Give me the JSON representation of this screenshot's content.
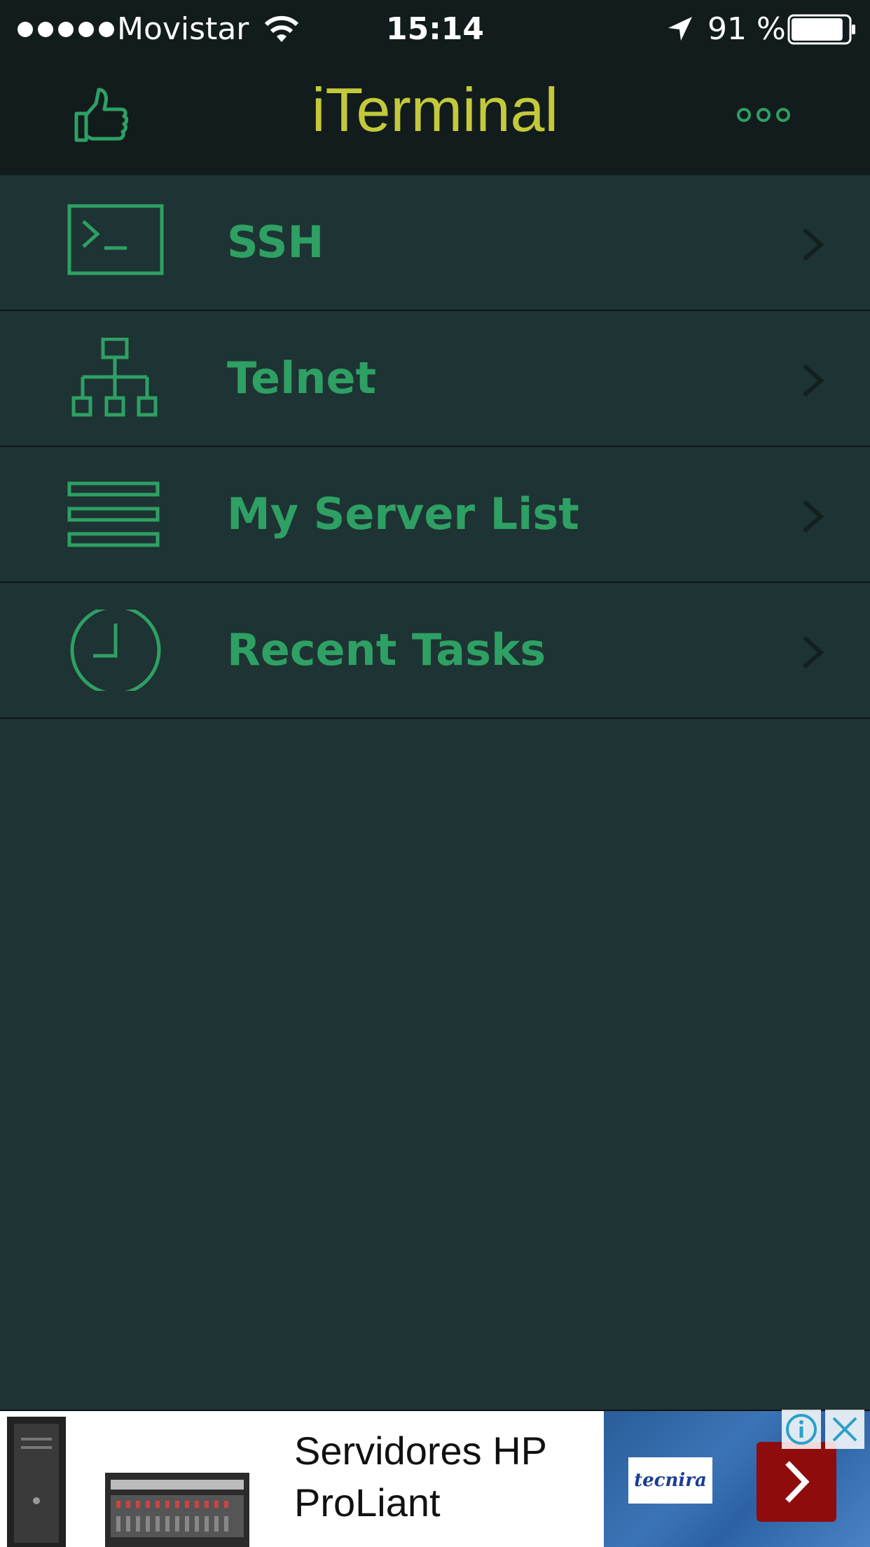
{
  "status_bar": {
    "signal_icon": "signal-dots-icon",
    "carrier": "Movistar",
    "wifi_icon": "wifi-icon",
    "time": "15:14",
    "location_icon": "location-arrow-icon",
    "battery_percent": "91 %",
    "battery_level": 0.91,
    "battery_icon": "battery-icon"
  },
  "nav": {
    "title": "iTerminal",
    "left_icon": "thumbs-up-icon",
    "right_icon": "more-dots-icon"
  },
  "menu": [
    {
      "label": "SSH",
      "icon": "terminal-icon"
    },
    {
      "label": "Telnet",
      "icon": "network-tree-icon"
    },
    {
      "label": "My Server List",
      "icon": "server-list-icon"
    },
    {
      "label": "Recent Tasks",
      "icon": "clock-icon"
    }
  ],
  "ad": {
    "headline_line1": "Servidores HP",
    "headline_line2": "ProLiant",
    "logo_text": "tecnira",
    "cta_icon": "chevron-right-icon",
    "info_icon": "info-icon",
    "close_icon": "close-icon"
  },
  "colors": {
    "background": "#1e3333",
    "navbar": "#121c1c",
    "title": "#c3c93a",
    "accent_green": "#2ea064",
    "chevron": "#142020"
  }
}
